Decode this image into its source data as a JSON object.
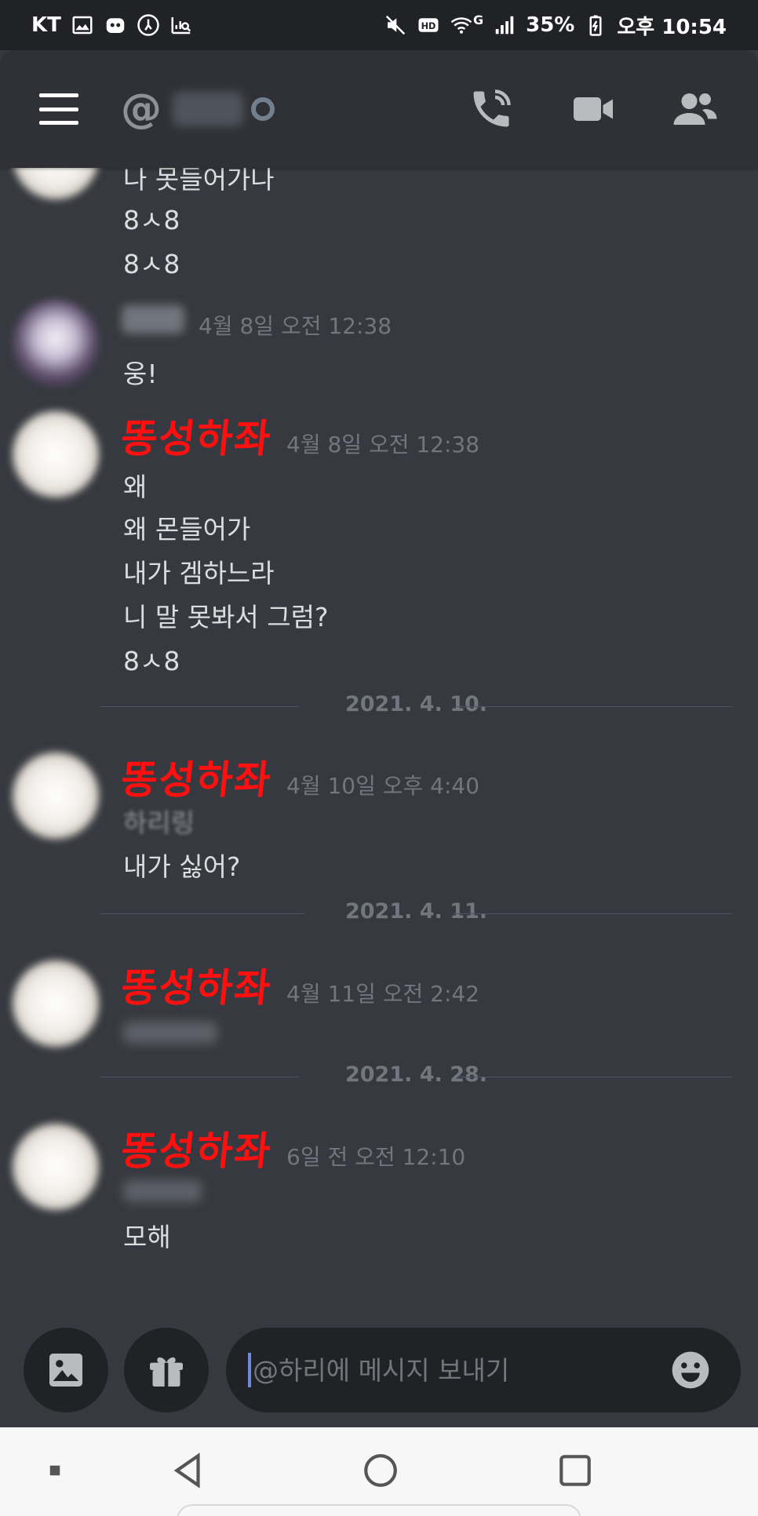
{
  "status_bar": {
    "carrier": "KT",
    "battery": "35%",
    "time": "오후 10:54",
    "network": "G"
  },
  "header": {
    "at_symbol": "@",
    "icons": [
      "menu-icon",
      "phone-call-icon",
      "video-call-icon",
      "members-icon"
    ]
  },
  "messages": [
    {
      "lines": [
        "나 못들어가나",
        "8ㅅ8",
        "8ㅅ8"
      ]
    },
    {
      "author_blurred": true,
      "timestamp": "4월 8일 오전 12:38",
      "lines": [
        "웅!"
      ]
    },
    {
      "author": "똥성하좌",
      "timestamp": "4월 8일 오전 12:38",
      "lines": [
        "왜",
        "왜 몬들어가",
        "내가 겜하느라",
        "니 말 못봐서 그럼?",
        "8ㅅ8"
      ]
    },
    {
      "divider": "2021. 4. 10."
    },
    {
      "author": "똥성하좌",
      "timestamp": "4월 10일 오후 4:40",
      "lines": [
        "하리링",
        "내가 싫어?"
      ]
    },
    {
      "divider": "2021. 4. 11."
    },
    {
      "author": "똥성하좌",
      "timestamp": "4월 11일 오전 2:42",
      "lines": []
    },
    {
      "divider": "2021. 4. 28."
    },
    {
      "author": "똥성하좌",
      "timestamp": "6일 전 오전 12:10",
      "lines": [
        "모해"
      ]
    }
  ],
  "composer": {
    "placeholder": "@하리에 메시지 보내기",
    "icons": [
      "image-icon",
      "gift-icon",
      "emoji-icon"
    ]
  },
  "nav": {
    "icons": [
      "recent-dot-icon",
      "back-icon",
      "home-icon",
      "recents-icon"
    ]
  },
  "colors": {
    "background": "#36393f",
    "header": "#2f3136",
    "input": "#202225",
    "username": "#ff1010",
    "timestamp": "#72767d",
    "accent": "#7289da"
  }
}
